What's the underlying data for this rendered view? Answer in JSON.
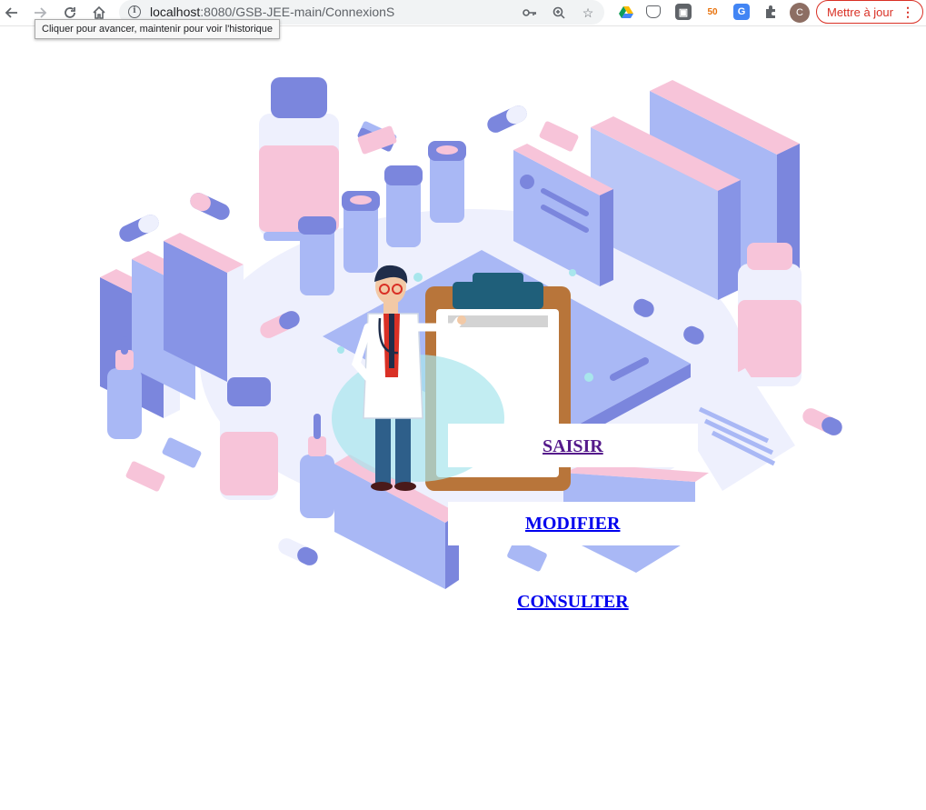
{
  "browser": {
    "url_host": "localhost",
    "url_path": ":8080/GSB-JEE-main/ConnexionS",
    "tooltip": "Cliquer pour avancer, maintenir pour voir l'historique",
    "update_button_label": "Mettre à jour",
    "avatar_initial": "C",
    "nav_icons": [
      "back-arrow-icon",
      "forward-arrow-icon",
      "reload-icon",
      "home-icon"
    ],
    "omnibox_icons": [
      "key-icon",
      "zoom-icon",
      "star-icon"
    ],
    "extensions": [
      "google-drive-icon",
      "pocket-icon",
      "extension-square-icon",
      "extension-50-icon",
      "translate-icon",
      "puzzle-icon"
    ]
  },
  "menu": {
    "links": [
      {
        "label": "SAISIR",
        "visited": true
      },
      {
        "label": "MODIFIER",
        "visited": false
      },
      {
        "label": "CONSULTER",
        "visited": false
      }
    ]
  },
  "colors": {
    "illustration_blue": "#a9b8f5",
    "illustration_dark_blue": "#7b86dd",
    "illustration_pink": "#f7c4d9",
    "clipboard_brown": "#b8753a",
    "link_visited": "#551a8b",
    "link_unvisited": "#0000ee",
    "update_red": "#d93025"
  }
}
